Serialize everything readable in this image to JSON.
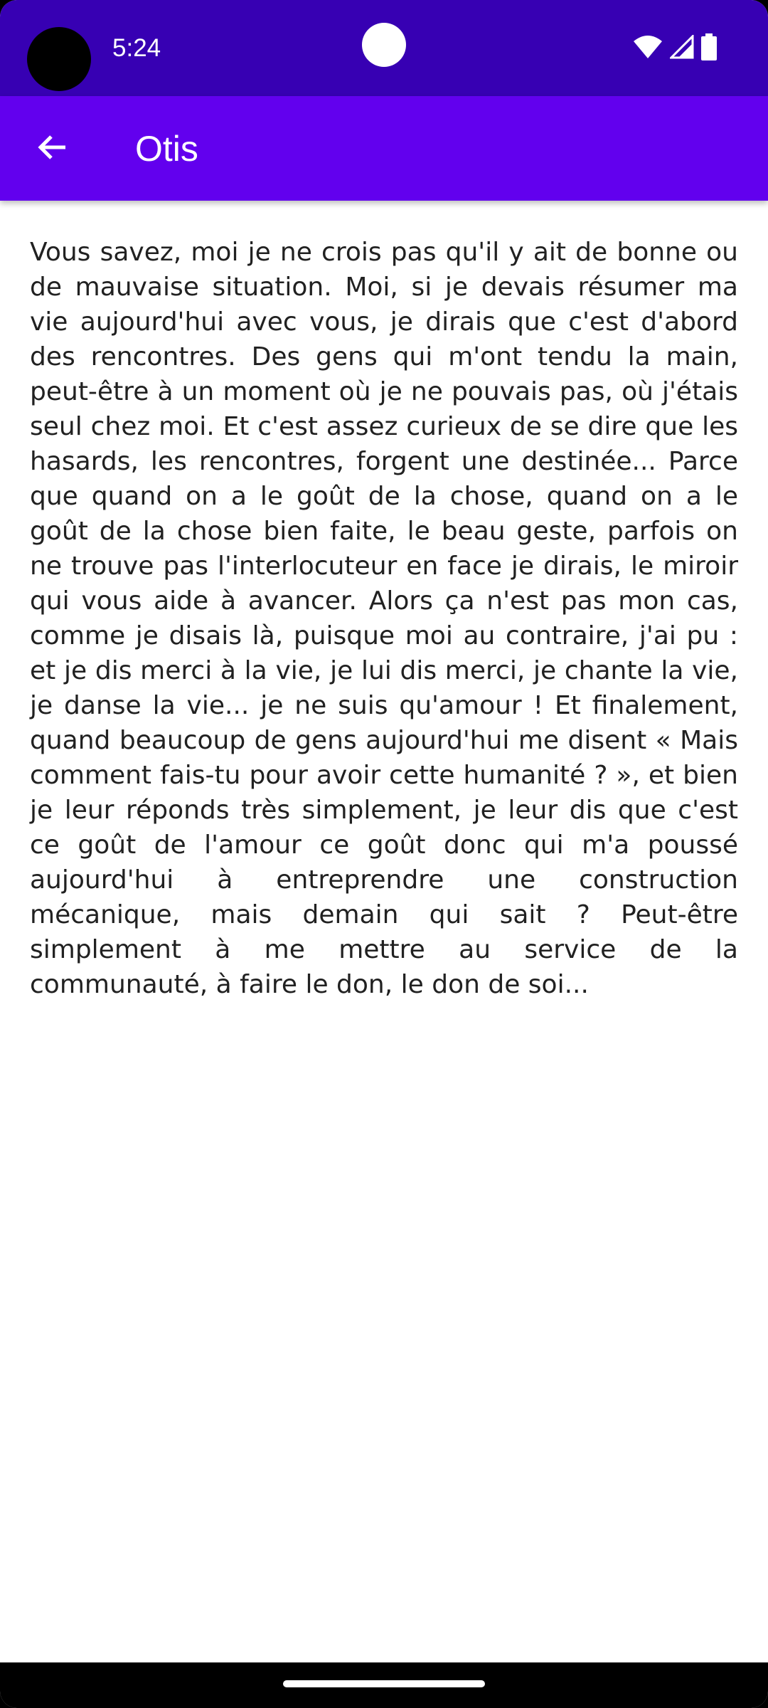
{
  "status_bar": {
    "time": "5:24",
    "icons": [
      "wifi-icon",
      "cellular-signal-icon",
      "battery-icon"
    ],
    "background": "#3700b3"
  },
  "app_bar": {
    "title": "Otis",
    "back_icon": "arrow-back-icon",
    "background": "#6200ee"
  },
  "content": {
    "body_text": "Vous savez, moi je ne crois pas qu'il y ait de bonne ou de mauvaise situation. Moi, si je devais résumer ma vie aujourd'hui avec vous, je dirais que c'est d'abord des rencontres. Des gens qui m'ont tendu la main, peut-être à un moment où je ne pouvais pas, où j'étais seul chez moi. Et c'est assez curieux de se dire que les hasards, les rencontres, forgent une destinée... Parce que quand on a le goût de la chose, quand on a le goût de la chose bien faite, le beau geste, parfois on ne trouve pas l'interlocuteur en face je dirais, le miroir qui vous aide à avancer. Alors ça n'est pas mon cas, comme je disais là, puisque moi au contraire, j'ai pu : et je dis merci à la vie, je lui dis merci, je chante la vie, je danse la vie... je ne suis qu'amour ! Et finalement, quand beaucoup de gens aujourd'hui me disent « Mais comment fais-tu pour avoir cette humanité ? », et bien je leur réponds très simplement, je leur dis que c'est ce goût de l'amour ce goût donc qui m'a poussé aujourd'hui à entreprendre une construction mécanique, mais demain qui sait ? Peut-être simplement à me mettre au service de la communauté, à faire le don, le don de soi..."
  },
  "nav_bar": {
    "home_indicator_icon": "home-gesture-bar"
  }
}
